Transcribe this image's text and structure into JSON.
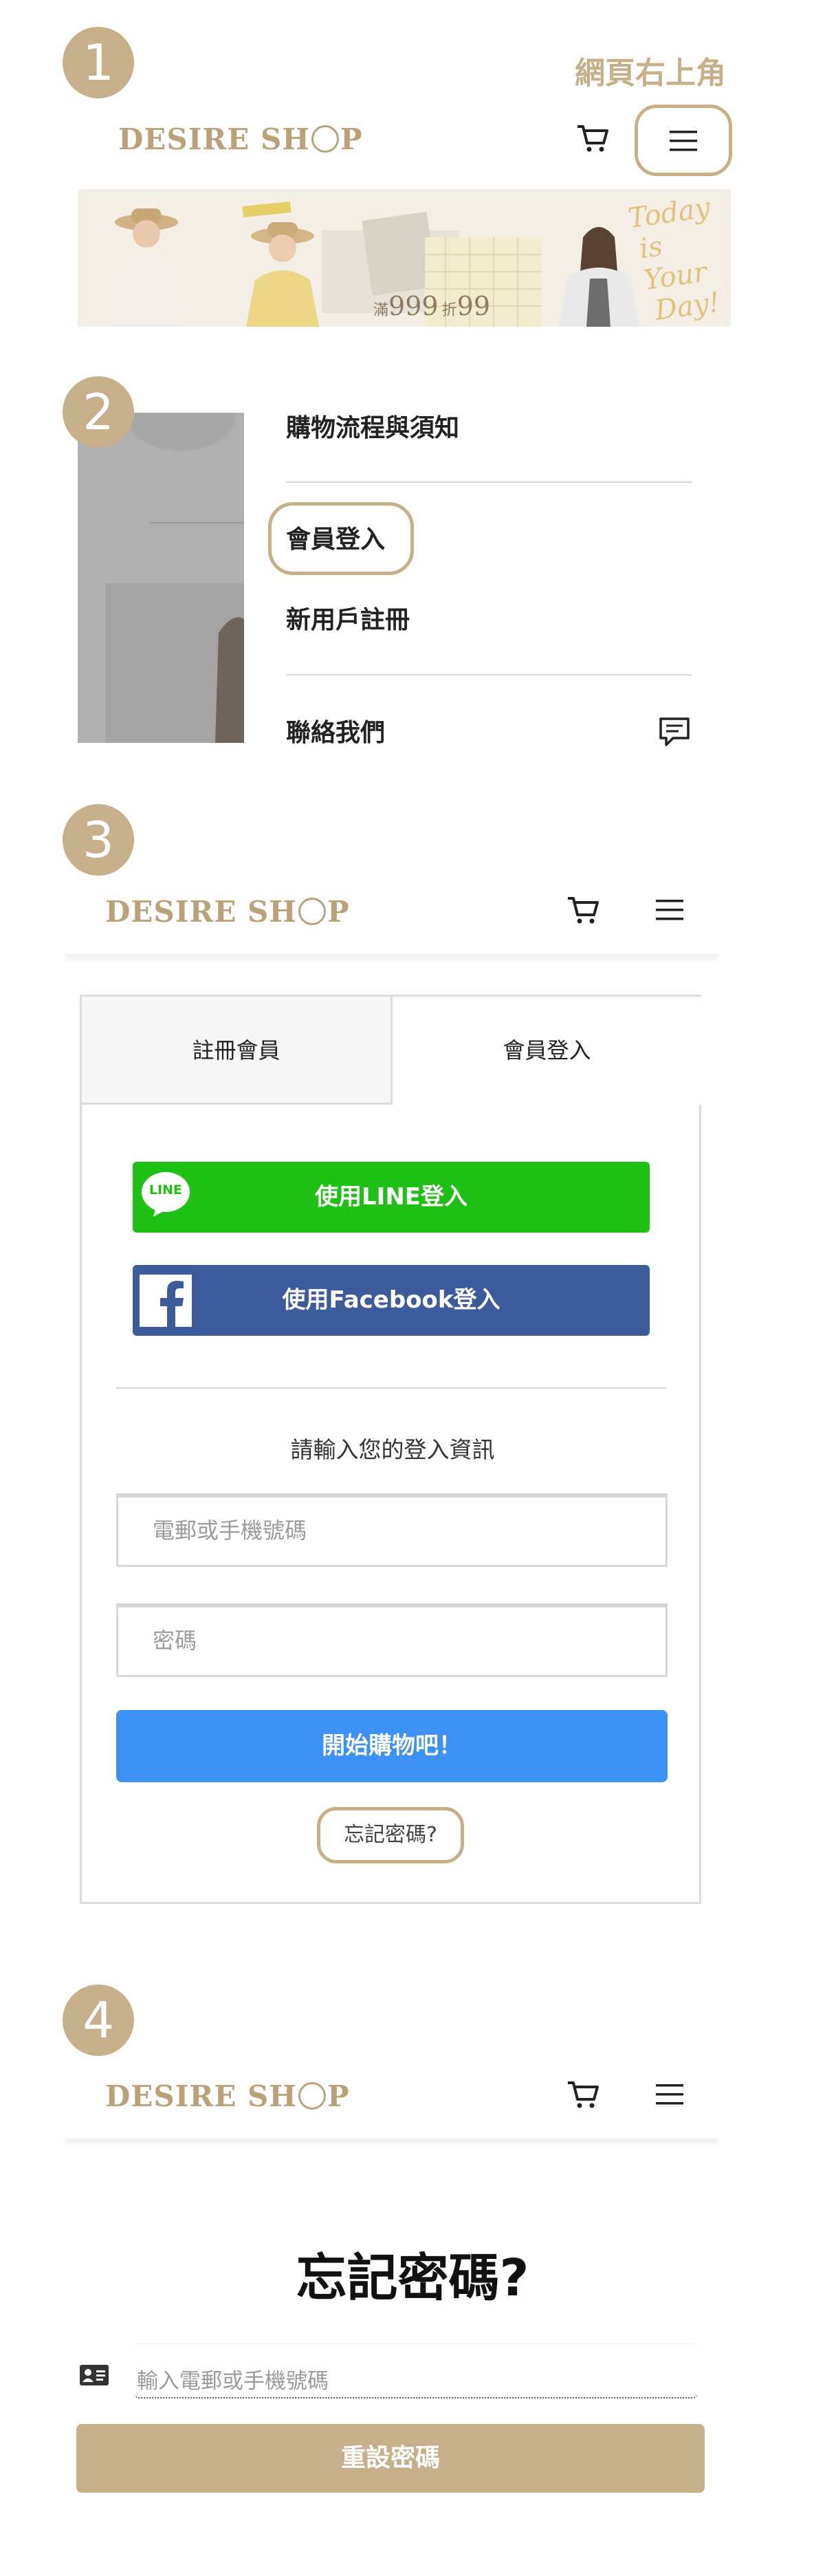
{
  "steps": [
    "1",
    "2",
    "3",
    "4"
  ],
  "brand": {
    "logo_before": "DESIRE SH",
    "logo_after": "P"
  },
  "section1": {
    "corner_note": "網頁右上角",
    "banner": {
      "promo_prefix": "滿",
      "promo_amount": "999",
      "promo_mid": "折",
      "promo_discount": "99",
      "script_text_1": "Today",
      "script_text_2": "is Your",
      "script_text_3": "Day!"
    }
  },
  "section2": {
    "menu_items": [
      "購物流程與須知",
      "會員登入",
      "新用戶註冊",
      "聯絡我們"
    ]
  },
  "section3": {
    "tabs": [
      "註冊會員",
      "會員登入"
    ],
    "line_badge": "LINE",
    "line_button": "使用LINE登入",
    "facebook_button": "使用Facebook登入",
    "prompt": "請輸入您的登入資訊",
    "account_placeholder": "電郵或手機號碼",
    "password_placeholder": "密碼",
    "submit_button": "開始購物吧！",
    "forgot_link": "忘記密碼?"
  },
  "section4": {
    "title": "忘記密碼?",
    "input_placeholder": "輸入電郵或手機號碼",
    "reset_button": "重設密碼"
  },
  "colors": {
    "accent": "#c5b08a",
    "line_green": "#1ec113",
    "facebook_blue": "#3b5b9b",
    "primary_blue": "#3d91f5",
    "reset_button": "#c5b08a"
  }
}
